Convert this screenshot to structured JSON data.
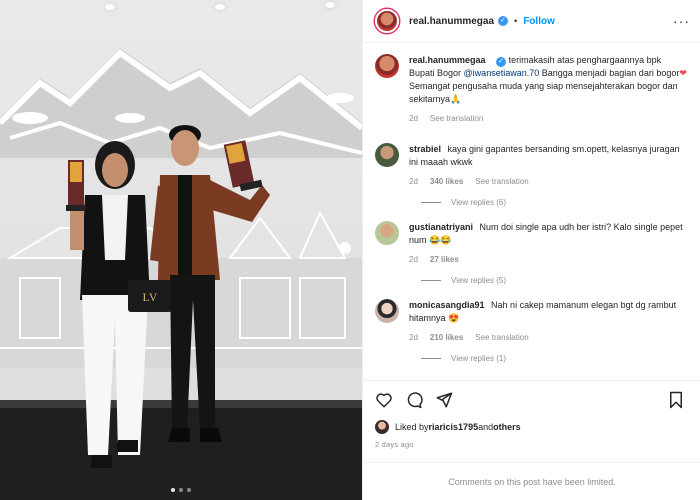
{
  "post": {
    "author": "real.hanummegaa",
    "follow_label": "Follow",
    "separator": "•",
    "more_label": "···"
  },
  "caption": {
    "user": "real.hanummegaa",
    "text_before": "terimakasih atas penghargaannya bpk Bupati Bogor ",
    "mention": "@iwansetiawan.70",
    "text_mid": " Bangga menjadi bagian dari bogor",
    "heart": "❤",
    "text_after": " Semangat pengusaha muda yang siap mensejahterakan bogor dan sekitarnya",
    "emoji": "🙏",
    "age": "2d",
    "see_translation": "See translation"
  },
  "comments": [
    {
      "user": "strabiel",
      "text": "kaya gini gapantes bersanding sm.opett, kelasnya juragan ini maaah wkwk",
      "age": "2d",
      "likes": "340 likes",
      "see_translation": "See translation",
      "replies": "View replies (6)",
      "avatar_color": "#4a5a3c"
    },
    {
      "user": "gustianatriyani",
      "text": "Num doi single apa udh ber istri? Kalo single pepet num",
      "emoji": "😂😂",
      "age": "2d",
      "likes": "27 likes",
      "replies": "View replies (5)",
      "avatar_color": "#b7c79a"
    },
    {
      "user": "monicasangdia91",
      "text": "Nah ni cakep mamanum elegan bgt dg rambut hitamnya",
      "emoji": "😍",
      "age": "2d",
      "likes": "210 likes",
      "see_translation": "See translation",
      "replies": "View replies (1)",
      "avatar_color": "#c9b3a6"
    }
  ],
  "actions": {
    "like_icon": "heart-icon",
    "comment_icon": "comment-icon",
    "share_icon": "share-icon",
    "save_icon": "bookmark-icon"
  },
  "likes": {
    "prefix": "Liked by ",
    "user": "riaricis1795",
    "middle": " and ",
    "suffix": "others"
  },
  "date": "2 days ago",
  "limited_text": "Comments on this post have been limited.",
  "colors": {
    "follow": "#0095f6",
    "verified": "#3897f0",
    "muted": "#8e8e8e",
    "mention": "#00376b"
  }
}
